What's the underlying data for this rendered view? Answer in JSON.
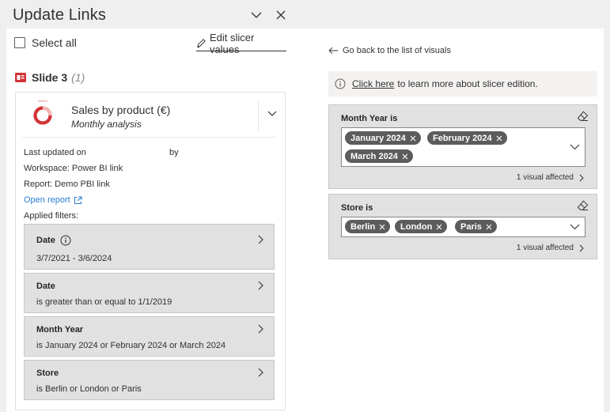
{
  "header": {
    "title": "Update Links",
    "collapse_icon": "chevron-down-icon",
    "close_icon": "close-icon"
  },
  "left": {
    "select_all_label": "Select all",
    "edit_slicer_label": "Edit slicer values",
    "slide": {
      "name": "Slide 3",
      "count": "(1)"
    },
    "visual": {
      "icon": "donut-chart-icon",
      "title": "Sales by product (€)",
      "subtitle": "Monthly analysis",
      "last_updated_label": "Last updated on",
      "by_label": "by",
      "workspace": "Workspace: Power BI link",
      "report": "Report: Demo PBI link",
      "open_report_label": "Open report",
      "applied_filters_label": "Applied filters:",
      "filters": [
        {
          "name": "Date",
          "desc": "3/7/2021 - 3/6/2024"
        },
        {
          "name": "Date",
          "desc": "is greater than or equal to 1/1/2019"
        },
        {
          "name": "Month Year",
          "desc": "is January 2024 or February 2024 or March 2024"
        },
        {
          "name": "Store",
          "desc": "is Berlin or London or Paris"
        }
      ]
    }
  },
  "right": {
    "back_label": "Go back to the list of visuals",
    "info_link": "Click here",
    "info_text": "to learn more about slicer edition.",
    "slicers": [
      {
        "label": "Month Year is",
        "values": [
          "January 2024",
          "February 2024",
          "March 2024"
        ],
        "affected": "1 visual affected"
      },
      {
        "label": "Store is",
        "values": [
          "Berlin",
          "London",
          "Paris"
        ],
        "affected": "1 visual affected"
      }
    ]
  },
  "colors": {
    "accent_red": "#d13438",
    "link_blue": "#2b7cd3",
    "pill_bg": "#5c5c5c"
  }
}
